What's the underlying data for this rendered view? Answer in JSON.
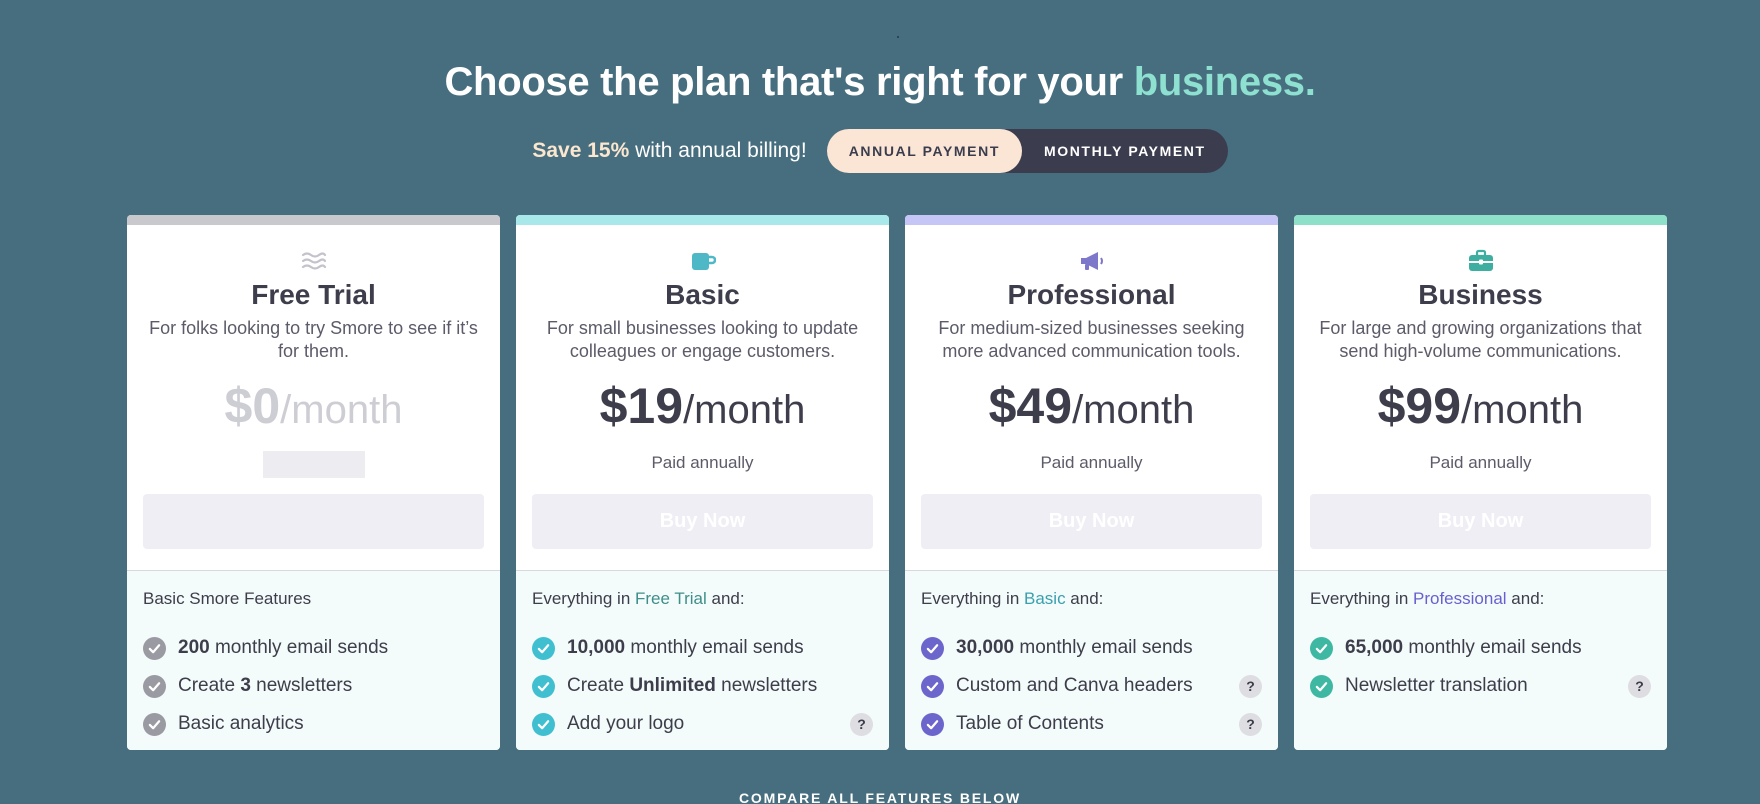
{
  "headline": {
    "main": "Choose the plan that's right for your ",
    "accent": "business."
  },
  "billing": {
    "save_bold": "Save 15%",
    "save_rest": " with annual billing!",
    "annual_label": "ANNUAL PAYMENT",
    "monthly_label": "MONTHLY PAYMENT",
    "selected": "annual"
  },
  "colors": {
    "background": "#476e7e",
    "accent_teal": "#8ee0d0",
    "free_bar": "#c9c8cd",
    "basic_bar": "#a8e8ea",
    "pro_bar": "#c5c6f5",
    "business_bar": "#8fe0c8",
    "basic_check": "#3fbfd0",
    "pro_check": "#6c65cc",
    "business_check": "#3eb8a2",
    "free_check": "#9a9aa2"
  },
  "plans": [
    {
      "id": "free",
      "icon": "waves-icon",
      "name": "Free Trial",
      "description": "For folks looking to try Smore to see if it’s for them.",
      "price": "$0",
      "per": "/month",
      "paid_note": "",
      "button_label": "",
      "intro_prefix": "Basic Smore Features",
      "intro_link": "",
      "intro_suffix": "",
      "features": [
        {
          "bold": "200",
          "text": " monthly email sends",
          "help": false
        },
        {
          "pre": "Create ",
          "bold": "3",
          "text": " newsletters",
          "help": false
        },
        {
          "text": "Basic analytics",
          "help": false
        }
      ]
    },
    {
      "id": "basic",
      "icon": "mug-icon",
      "name": "Basic",
      "description": "For small businesses looking to update colleagues or engage customers.",
      "price": "$19",
      "per": "/month",
      "paid_note": "Paid annually",
      "button_label": "Buy Now",
      "intro_prefix": "Everything in ",
      "intro_link": "Free Trial",
      "intro_suffix": " and:",
      "features": [
        {
          "bold": "10,000",
          "text": " monthly email sends",
          "help": false
        },
        {
          "pre": "Create ",
          "bold": "Unlimited",
          "text": " newsletters",
          "help": false
        },
        {
          "text": "Add your logo",
          "help": true
        }
      ]
    },
    {
      "id": "professional",
      "icon": "megaphone-icon",
      "name": "Professional",
      "description": "For medium-sized businesses seeking more advanced communication tools.",
      "price": "$49",
      "per": "/month",
      "paid_note": "Paid annually",
      "button_label": "Buy Now",
      "intro_prefix": "Everything in ",
      "intro_link": "Basic",
      "intro_suffix": " and:",
      "features": [
        {
          "bold": "30,000",
          "text": " monthly email sends",
          "help": false
        },
        {
          "text": "Custom and Canva headers",
          "help": true
        },
        {
          "text": "Table of Contents",
          "help": true
        }
      ]
    },
    {
      "id": "business",
      "icon": "briefcase-icon",
      "name": "Business",
      "description": "For large and growing organizations that send high-volume communications.",
      "price": "$99",
      "per": "/month",
      "paid_note": "Paid annually",
      "button_label": "Buy Now",
      "intro_prefix": "Everything in ",
      "intro_link": "Professional",
      "intro_suffix": " and:",
      "features": [
        {
          "bold": "65,000",
          "text": " monthly email sends",
          "help": false
        },
        {
          "text": "Newsletter translation",
          "help": true
        }
      ]
    }
  ],
  "help_glyph": "?",
  "compare_label": "COMPARE ALL FEATURES BELOW"
}
